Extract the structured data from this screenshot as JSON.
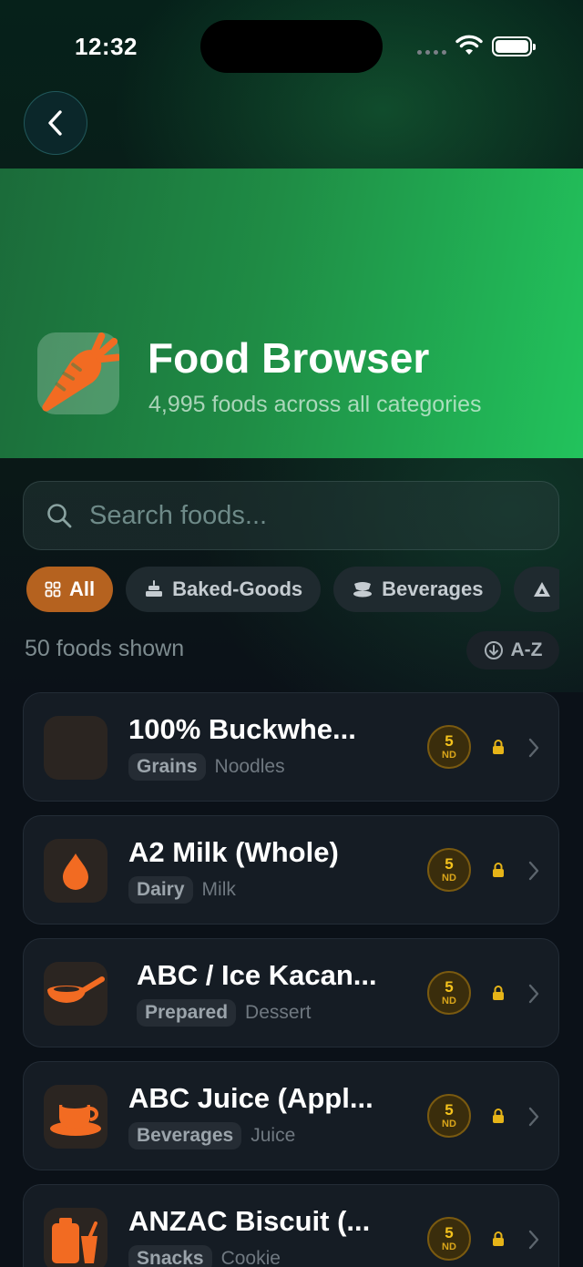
{
  "status_bar": {
    "time": "12:32"
  },
  "header": {
    "title": "Food Browser",
    "subtitle": "4,995 foods across all categories",
    "accent": "#22c35c"
  },
  "search": {
    "placeholder": "Search foods..."
  },
  "filters": [
    {
      "label": "All",
      "icon": "grid-icon",
      "active": true
    },
    {
      "label": "Baked-Goods",
      "icon": "cake-icon",
      "active": false
    },
    {
      "label": "Beverages",
      "icon": "cup-icon",
      "active": false
    },
    {
      "label": "",
      "icon": "triangle-icon",
      "active": false
    }
  ],
  "results": {
    "count_label": "50 foods shown",
    "sort_label": "A-Z"
  },
  "foods": [
    {
      "name": "100% Buckwhe...",
      "category": "Grains",
      "subcategory": "Noodles",
      "icon": "blank-thumbnail",
      "score": "5",
      "score_label": "ND"
    },
    {
      "name": "A2 Milk (Whole)",
      "category": "Dairy",
      "subcategory": "Milk",
      "icon": "droplet-icon",
      "score": "5",
      "score_label": "ND"
    },
    {
      "name": "ABC / Ice Kacan...",
      "category": "Prepared",
      "subcategory": "Dessert",
      "icon": "frying-pan-icon",
      "score": "5",
      "score_label": "ND"
    },
    {
      "name": "ABC Juice (Appl...",
      "category": "Beverages",
      "subcategory": "Juice",
      "icon": "coffee-cup-icon",
      "score": "5",
      "score_label": "ND"
    },
    {
      "name": "ANZAC Biscuit (...",
      "category": "Snacks",
      "subcategory": "Cookie",
      "icon": "snack-icon",
      "score": "5",
      "score_label": "ND"
    }
  ]
}
